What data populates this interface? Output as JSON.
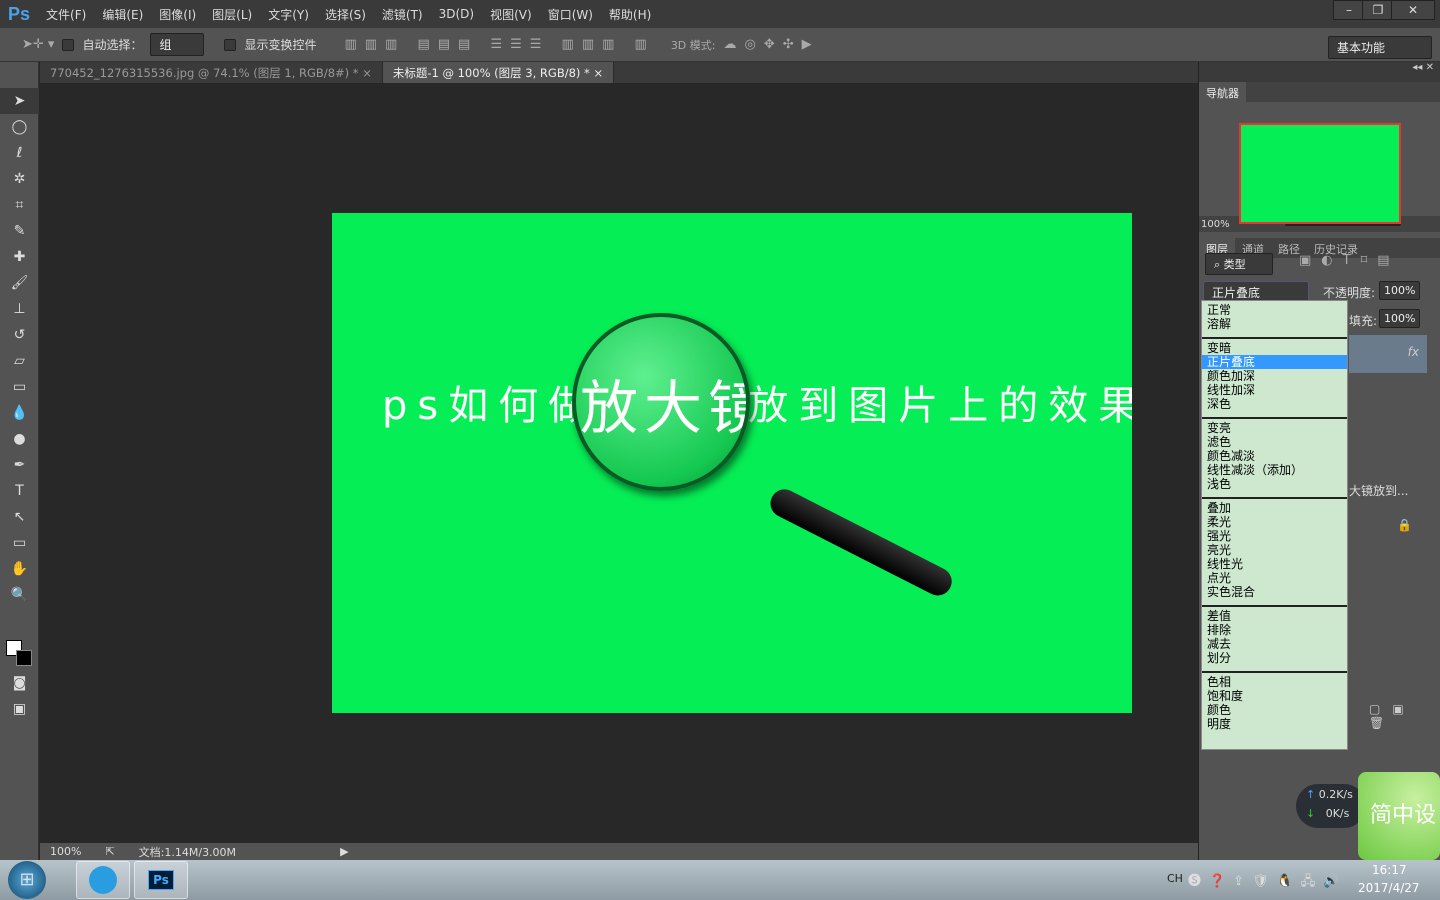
{
  "app": {
    "logo": "Ps",
    "menus": [
      "文件(F)",
      "编辑(E)",
      "图像(I)",
      "图层(L)",
      "文字(Y)",
      "选择(S)",
      "滤镜(T)",
      "3D(D)",
      "视图(V)",
      "窗口(W)",
      "帮助(H)"
    ],
    "min": "–",
    "restore": "❐",
    "close": "✕"
  },
  "options": {
    "auto_select": "自动选择：",
    "group": "组",
    "show_transform": "显示变换控件",
    "mode3d": "3D 模式:",
    "workspace": "基本功能"
  },
  "tabs": [
    {
      "label": "770452_1276315536.jpg @ 74.1% (图层 1, RGB/8#) *",
      "close": "×"
    },
    {
      "label": "未标题-1 @ 100% (图层 3, RGB/8) *",
      "close": "×"
    }
  ],
  "canvas": {
    "text": "ps如何做放大镜放到图片上的效果",
    "lens_text": "放大镜"
  },
  "navigator": {
    "title": "导航器",
    "zoom": "100%"
  },
  "layers": {
    "tabs": [
      "图层",
      "通道",
      "路径",
      "历史记录"
    ],
    "filter": "类型",
    "blend": "正片叠底",
    "opacity_label": "不透明度:",
    "opacity": "100%",
    "fill_label": "填充:",
    "fill": "100%",
    "layer_name": "大镜放到...",
    "fx": "fx"
  },
  "blend_groups": [
    [
      "正常",
      "溶解"
    ],
    [
      "变暗",
      "正片叠底",
      "颜色加深",
      "线性加深",
      "深色"
    ],
    [
      "变亮",
      "滤色",
      "颜色减淡",
      "线性减淡（添加）",
      "浅色"
    ],
    [
      "叠加",
      "柔光",
      "强光",
      "亮光",
      "线性光",
      "点光",
      "实色混合"
    ],
    [
      "差值",
      "排除",
      "减去",
      "划分"
    ],
    [
      "色相",
      "饱和度",
      "颜色",
      "明度"
    ]
  ],
  "status": {
    "zoom": "100%",
    "doc": "文档:1.14M/3.00M"
  },
  "net": {
    "up": "0.2K/s",
    "down": "0K/s"
  },
  "widget": "简中设",
  "taskbar": {
    "lang": "CH",
    "time": "16:17",
    "date": "2017/4/27",
    "ps": "Ps"
  }
}
